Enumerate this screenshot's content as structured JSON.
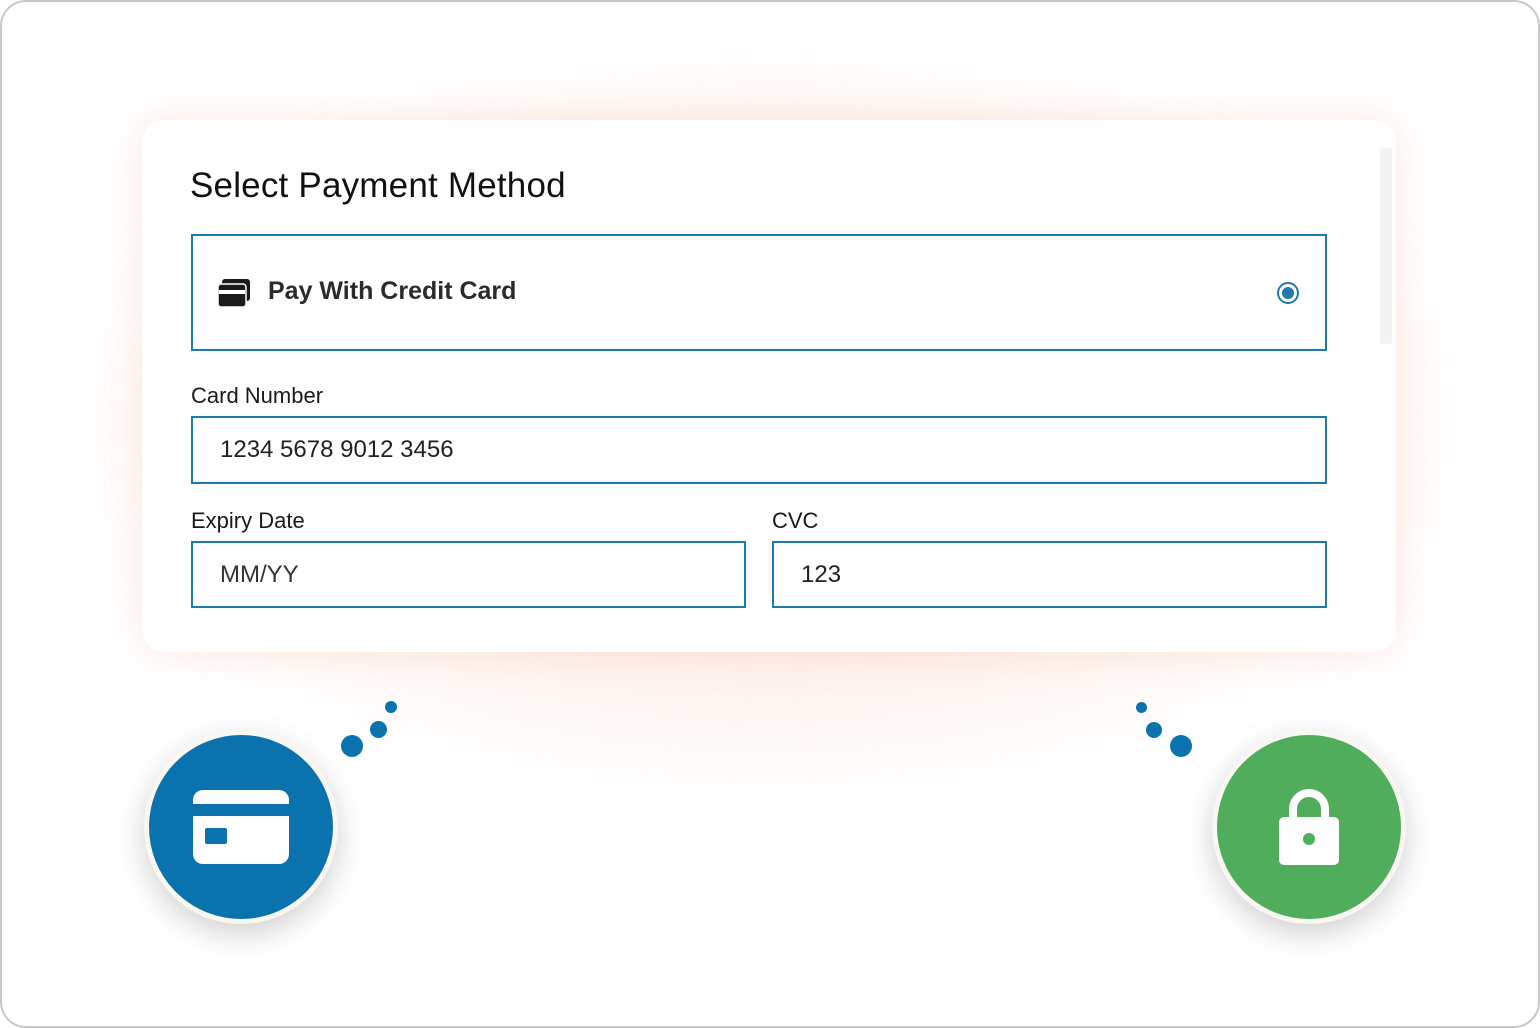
{
  "colors": {
    "accent": "#1f7aab",
    "card_circle": "#0a73ad",
    "lock_circle": "#4fad5b",
    "glow": "#fbd6c8"
  },
  "payment": {
    "title": "Select Payment Method",
    "method": {
      "label": "Pay With Credit Card",
      "icon": "credit-card-icon",
      "selected": true
    },
    "card_number": {
      "label": "Card Number",
      "value": "1234 5678 9012 3456"
    },
    "expiry": {
      "label": "Expiry Date",
      "placeholder": "MM/YY"
    },
    "cvc": {
      "label": "CVC",
      "value": "123"
    }
  },
  "decorations": {
    "left_icon": "credit-card-icon",
    "right_icon": "lock-icon"
  }
}
